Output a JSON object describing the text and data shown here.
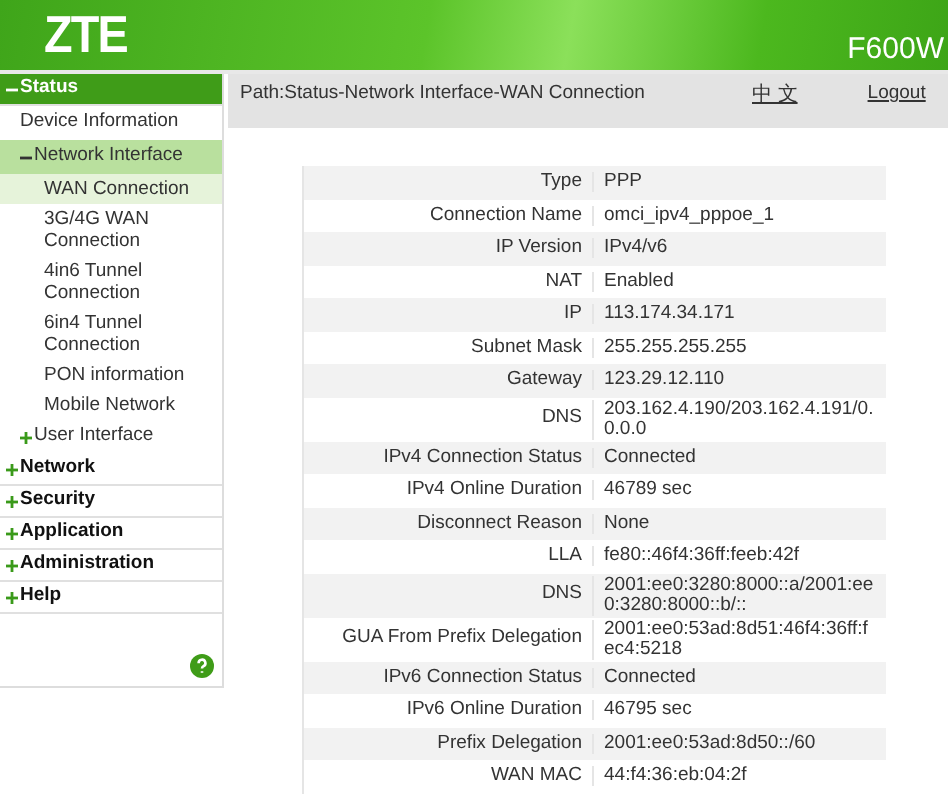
{
  "header": {
    "logo": "ZTE",
    "model": "F600W"
  },
  "sidebar": {
    "items": [
      {
        "label": "Status",
        "expanded": true,
        "children": [
          {
            "label": "Device Information",
            "selected": false
          },
          {
            "label": "Network Interface",
            "expanded": true,
            "children": [
              {
                "label": "WAN Connection",
                "selected": true
              },
              {
                "label": "3G/4G WAN Connection",
                "selected": false
              },
              {
                "label": "4in6 Tunnel Connection",
                "selected": false
              },
              {
                "label": "6in4 Tunnel Connection",
                "selected": false
              },
              {
                "label": "PON information",
                "selected": false
              },
              {
                "label": "Mobile Network",
                "selected": false
              }
            ]
          },
          {
            "label": "User Interface",
            "expanded": false,
            "selected": false
          }
        ]
      },
      {
        "label": "Network",
        "expanded": false,
        "selected": false
      },
      {
        "label": "Security",
        "expanded": false,
        "selected": false
      },
      {
        "label": "Application",
        "expanded": false,
        "selected": false
      },
      {
        "label": "Administration",
        "expanded": false,
        "selected": false
      },
      {
        "label": "Help",
        "expanded": false,
        "selected": false
      }
    ]
  },
  "path_bar": {
    "path": "Path:Status-Network Interface-WAN Connection",
    "language_link": "中 文",
    "logout_link": "Logout"
  },
  "table": {
    "rows": [
      {
        "label": "Type",
        "value": "PPP"
      },
      {
        "label": "Connection Name",
        "value": "omci_ipv4_pppoe_1"
      },
      {
        "label": "IP Version",
        "value": "IPv4/v6"
      },
      {
        "label": "NAT",
        "value": "Enabled"
      },
      {
        "label": "IP",
        "value": "113.174.34.171"
      },
      {
        "label": "Subnet Mask",
        "value": "255.255.255.255"
      },
      {
        "label": "Gateway",
        "value": "123.29.12.110"
      },
      {
        "label": "DNS",
        "value": "203.162.4.190/203.162.4.191/0.0.0.0"
      },
      {
        "label": "IPv4 Connection Status",
        "value": "Connected"
      },
      {
        "label": "IPv4 Online Duration",
        "value": "46789 sec"
      },
      {
        "label": "Disconnect Reason",
        "value": "None"
      },
      {
        "label": "LLA",
        "value": "fe80::46f4:36ff:feeb:42f"
      },
      {
        "label": "DNS",
        "value": "2001:ee0:3280:8000::a/2001:ee0:3280:8000::b/::"
      },
      {
        "label": "GUA From Prefix Delegation",
        "value": "2001:ee0:53ad:8d51:46f4:36ff:fec4:5218"
      },
      {
        "label": "IPv6 Connection Status",
        "value": "Connected"
      },
      {
        "label": "IPv6 Online Duration",
        "value": "46795 sec"
      },
      {
        "label": "Prefix Delegation",
        "value": "2001:ee0:53ad:8d50::/60"
      },
      {
        "label": "WAN MAC",
        "value": "44:f4:36:eb:04:2f"
      }
    ]
  }
}
